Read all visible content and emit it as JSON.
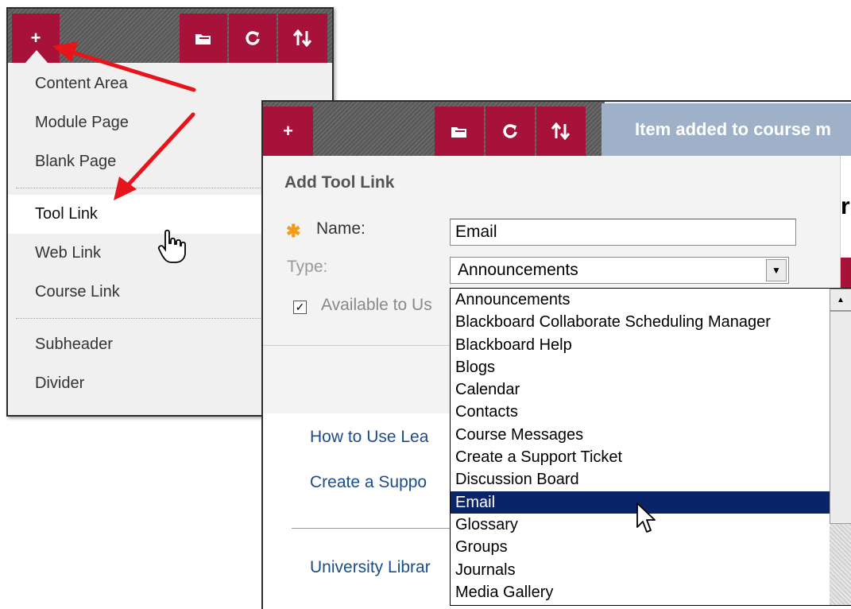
{
  "back_toolbar": {
    "add_label": "+",
    "icons": [
      "folder-icon",
      "refresh-icon",
      "sort-icon"
    ]
  },
  "menu": {
    "items": [
      {
        "label": "Content Area"
      },
      {
        "label": "Module Page"
      },
      {
        "label": "Blank Page"
      },
      {
        "label": "Tool Link",
        "active": true
      },
      {
        "label": "Web Link"
      },
      {
        "label": "Course Link"
      },
      {
        "label": "Subheader"
      },
      {
        "label": "Divider"
      }
    ]
  },
  "front_toolbar": {
    "add_label": "+",
    "notice": "Item added to course m"
  },
  "form": {
    "title": "Add Tool Link",
    "required_mark": "✱",
    "name_label": "Name:",
    "name_value": "Email",
    "type_label": "Type:",
    "type_value": "Announcements",
    "available_label": "Available to Us",
    "available_checked": "✓"
  },
  "partial_text": "r",
  "page_links": [
    "How to Use Lea",
    "Create a Suppo",
    "University Librar"
  ],
  "dropdown": {
    "options": [
      "Announcements",
      "Blackboard Collaborate Scheduling Manager",
      "Blackboard Help",
      "Blogs",
      "Calendar",
      "Contacts",
      "Course Messages",
      "Create a Support Ticket",
      "Discussion Board",
      "Email",
      "Glossary",
      "Groups",
      "Journals",
      "Media Gallery"
    ],
    "selected": "Email"
  },
  "colors": {
    "brand_red": "#a6123a",
    "highlight": "#0a246a",
    "annotation_arrow": "#e8141c",
    "required_star": "#f39a18",
    "notice_bar": "#9fb1c9"
  }
}
